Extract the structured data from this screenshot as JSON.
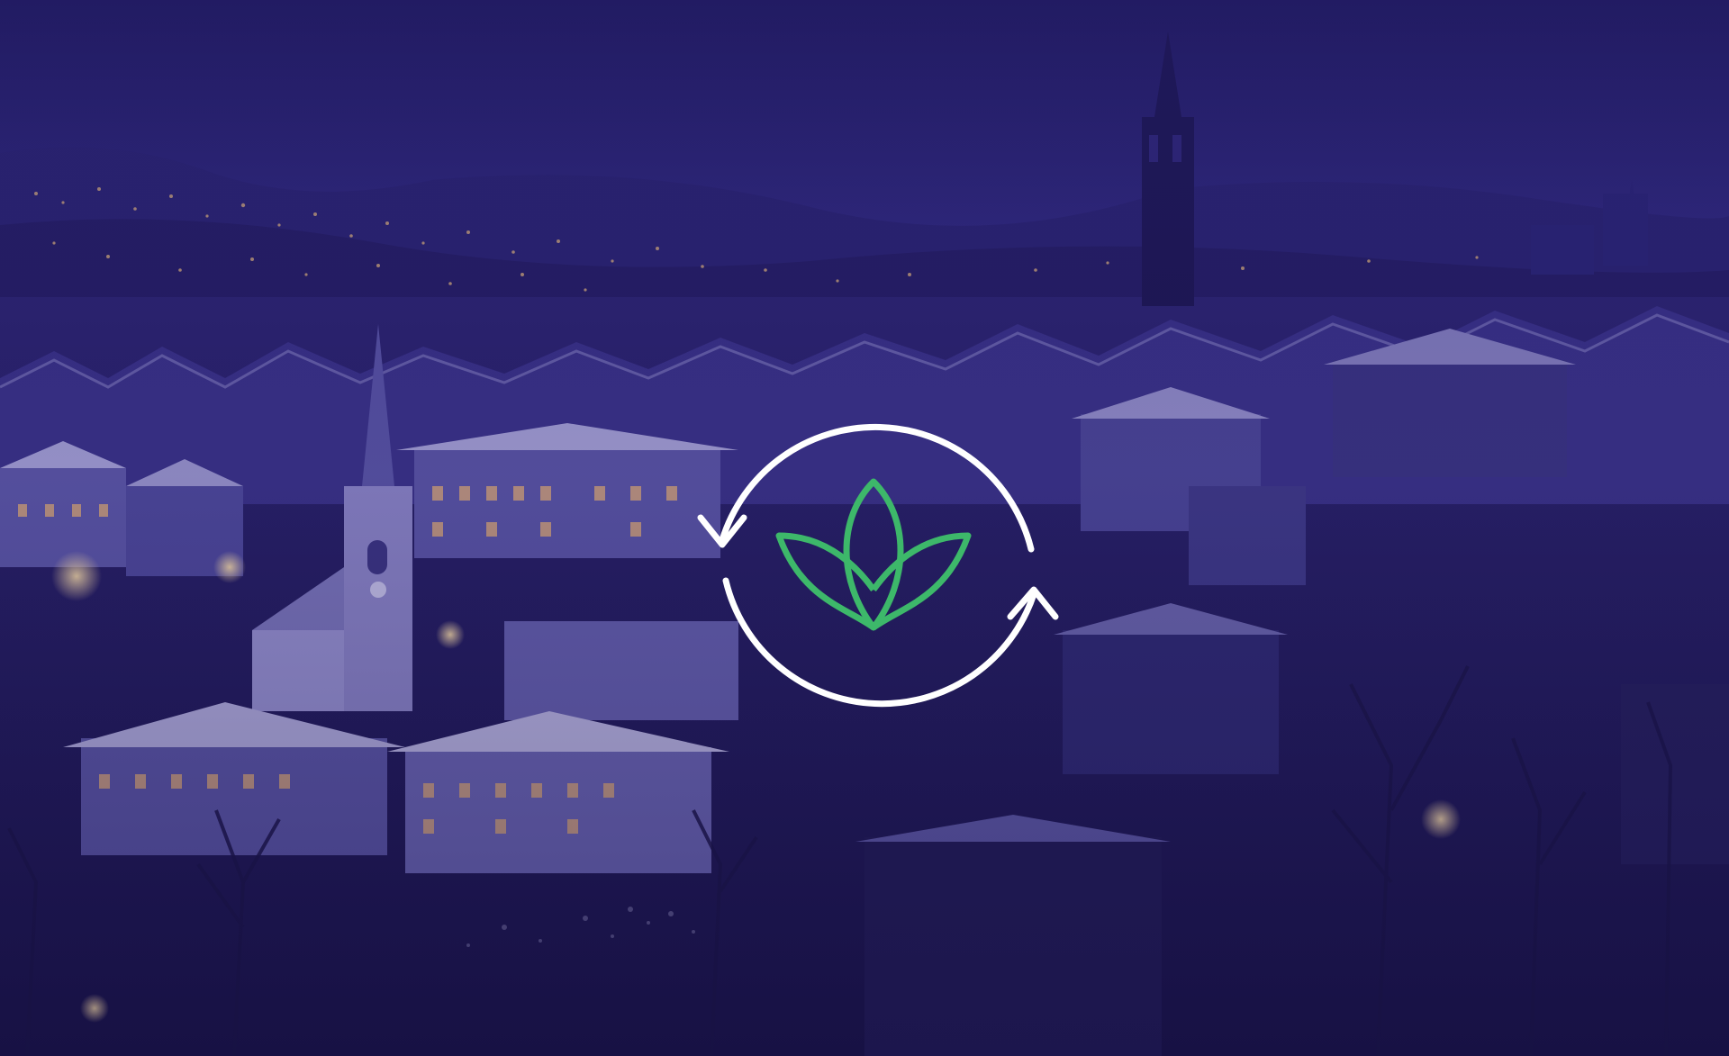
{
  "scene": {
    "description_icon": "city-night-background",
    "overlay_color": "#2a2170"
  },
  "logo": {
    "icon": "refresh-leaf-icon",
    "ring_color": "#ffffff",
    "leaf_color": "#3db86a"
  }
}
